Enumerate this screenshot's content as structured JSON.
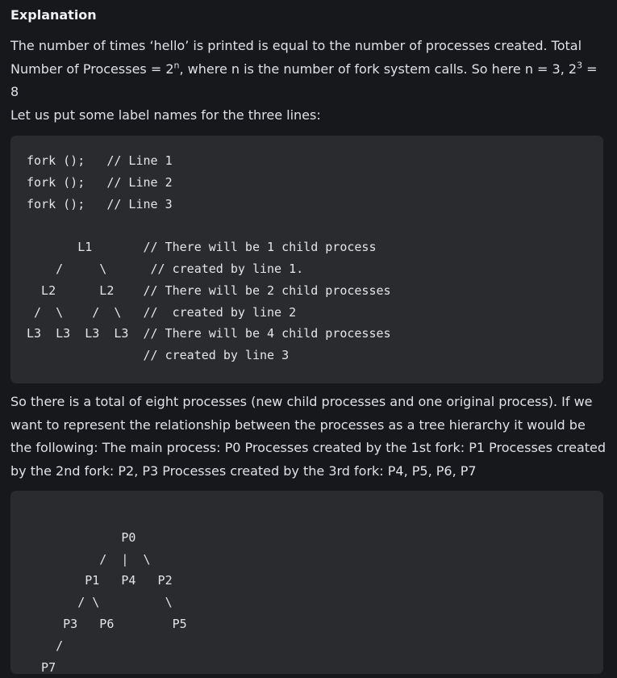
{
  "heading": "Explanation",
  "intro": {
    "line1": "The number of times ‘hello’ is printed is equal to the number of processes created. Total",
    "line2_a": "Number of Processes = 2",
    "line2_sup_n": "n",
    "line2_b": ", where n is the number of fork system calls. So here n = 3, 2",
    "line2_sup_3": "3",
    "line2_c": " = 8",
    "line3": "Let us put some label names for the three lines:"
  },
  "code_block_1": "fork ();   // Line 1\nfork ();   // Line 2\nfork ();   // Line 3\n\n       L1       // There will be 1 child process\n    /     \\      // created by line 1.\n  L2      L2    // There will be 2 child processes\n /  \\    /  \\   //  created by line 2\nL3  L3  L3  L3  // There will be 4 child processes\n                // created by line 3",
  "explanation_2": "So there is a total of eight processes (new child processes and one original process). If we want to represent the relationship between the processes as a tree hierarchy it would be the following: The main process: P0 Processes created by the 1st fork: P1 Processes created by the 2nd fork: P2, P3 Processes created by the 3rd fork: P4, P5, P6, P7",
  "code_block_2": "\n             P0\n          /  |  \\\n        P1   P4   P2\n       / \\         \\\n     P3   P6        P5\n    /\n  P7"
}
